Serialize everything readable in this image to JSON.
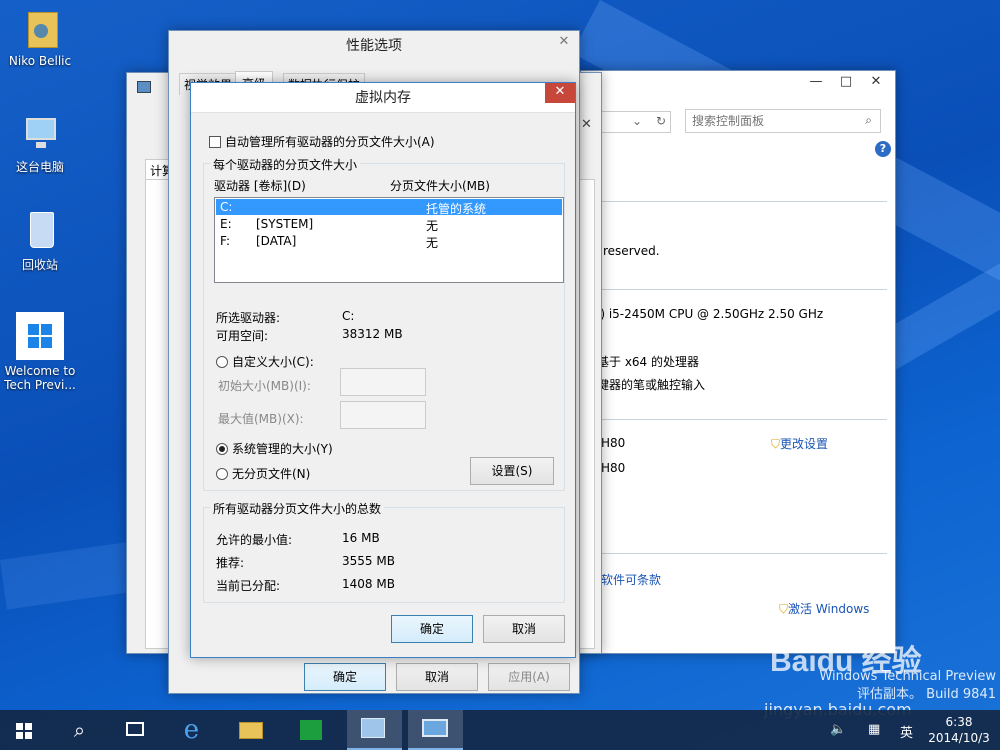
{
  "desktop": {
    "icons": [
      {
        "label": "Niko Bellic",
        "icon": "folder-user-icon"
      },
      {
        "label": "这台电脑",
        "icon": "computer-icon"
      },
      {
        "label": "回收站",
        "icon": "recycle-bin-icon"
      },
      {
        "label": "Welcome to Tech Previ...",
        "icon": "windows-logo-icon"
      }
    ]
  },
  "perf_options": {
    "title": "性能选项",
    "tabs": [
      "视觉效果",
      "高级",
      "数据执行保护"
    ],
    "buttons": {
      "ok": "确定",
      "cancel": "取消",
      "apply": "应用(A)"
    }
  },
  "sysprops": {
    "tab": "计算"
  },
  "control_panel": {
    "search_placeholder": "搜索控制面板",
    "copyright": "reserved.",
    "cpu": "i) i5-2450M CPU @ 2.50GHz   2.50 GHz",
    "os_type": "基于 x64 的处理器",
    "pen": "键器的笔或触控输入",
    "computer_name": "H80",
    "full_name": "H80",
    "change_settings": "更改设置",
    "license_terms": "软件可条款",
    "activate": "激活 Windows"
  },
  "virtual_memory": {
    "title": "虚拟内存",
    "auto_manage": "自动管理所有驱动器的分页文件大小(A)",
    "per_drive_group": "每个驱动器的分页文件大小",
    "col_drive": "驱动器 [卷标](D)",
    "col_size": "分页文件大小(MB)",
    "drives": [
      {
        "drive": "C:",
        "label": "",
        "size": "托管的系统",
        "selected": true
      },
      {
        "drive": "E:",
        "label": "[SYSTEM]",
        "size": "无",
        "selected": false
      },
      {
        "drive": "F:",
        "label": "[DATA]",
        "size": "无",
        "selected": false
      }
    ],
    "selected_drive_label": "所选驱动器:",
    "selected_drive_value": "C:",
    "free_space_label": "可用空间:",
    "free_space_value": "38312 MB",
    "custom_size": "自定义大小(C):",
    "initial_size": "初始大小(MB)(I):",
    "max_size": "最大值(MB)(X):",
    "system_managed": "系统管理的大小(Y)",
    "no_paging": "无分页文件(N)",
    "set_button": "设置(S)",
    "total_group": "所有驱动器分页文件大小的总数",
    "min_allowed_label": "允许的最小值:",
    "min_allowed_value": "16 MB",
    "recommended_label": "推荐:",
    "recommended_value": "3555 MB",
    "allocated_label": "当前已分配:",
    "allocated_value": "1408 MB",
    "ok": "确定",
    "cancel": "取消"
  },
  "watermark": {
    "line1": "Windows Technical Preview",
    "line2": "评估副本。 Build 9841",
    "baidu": "Baidu 经验",
    "site": "jingyan.baidu.com"
  },
  "taskbar": {
    "time": "6:38",
    "date": "2014/10/3",
    "ime": "英"
  },
  "colors": {
    "accent": "#3399ff",
    "selection": "#3399ff",
    "close_red": "#c7473a"
  }
}
